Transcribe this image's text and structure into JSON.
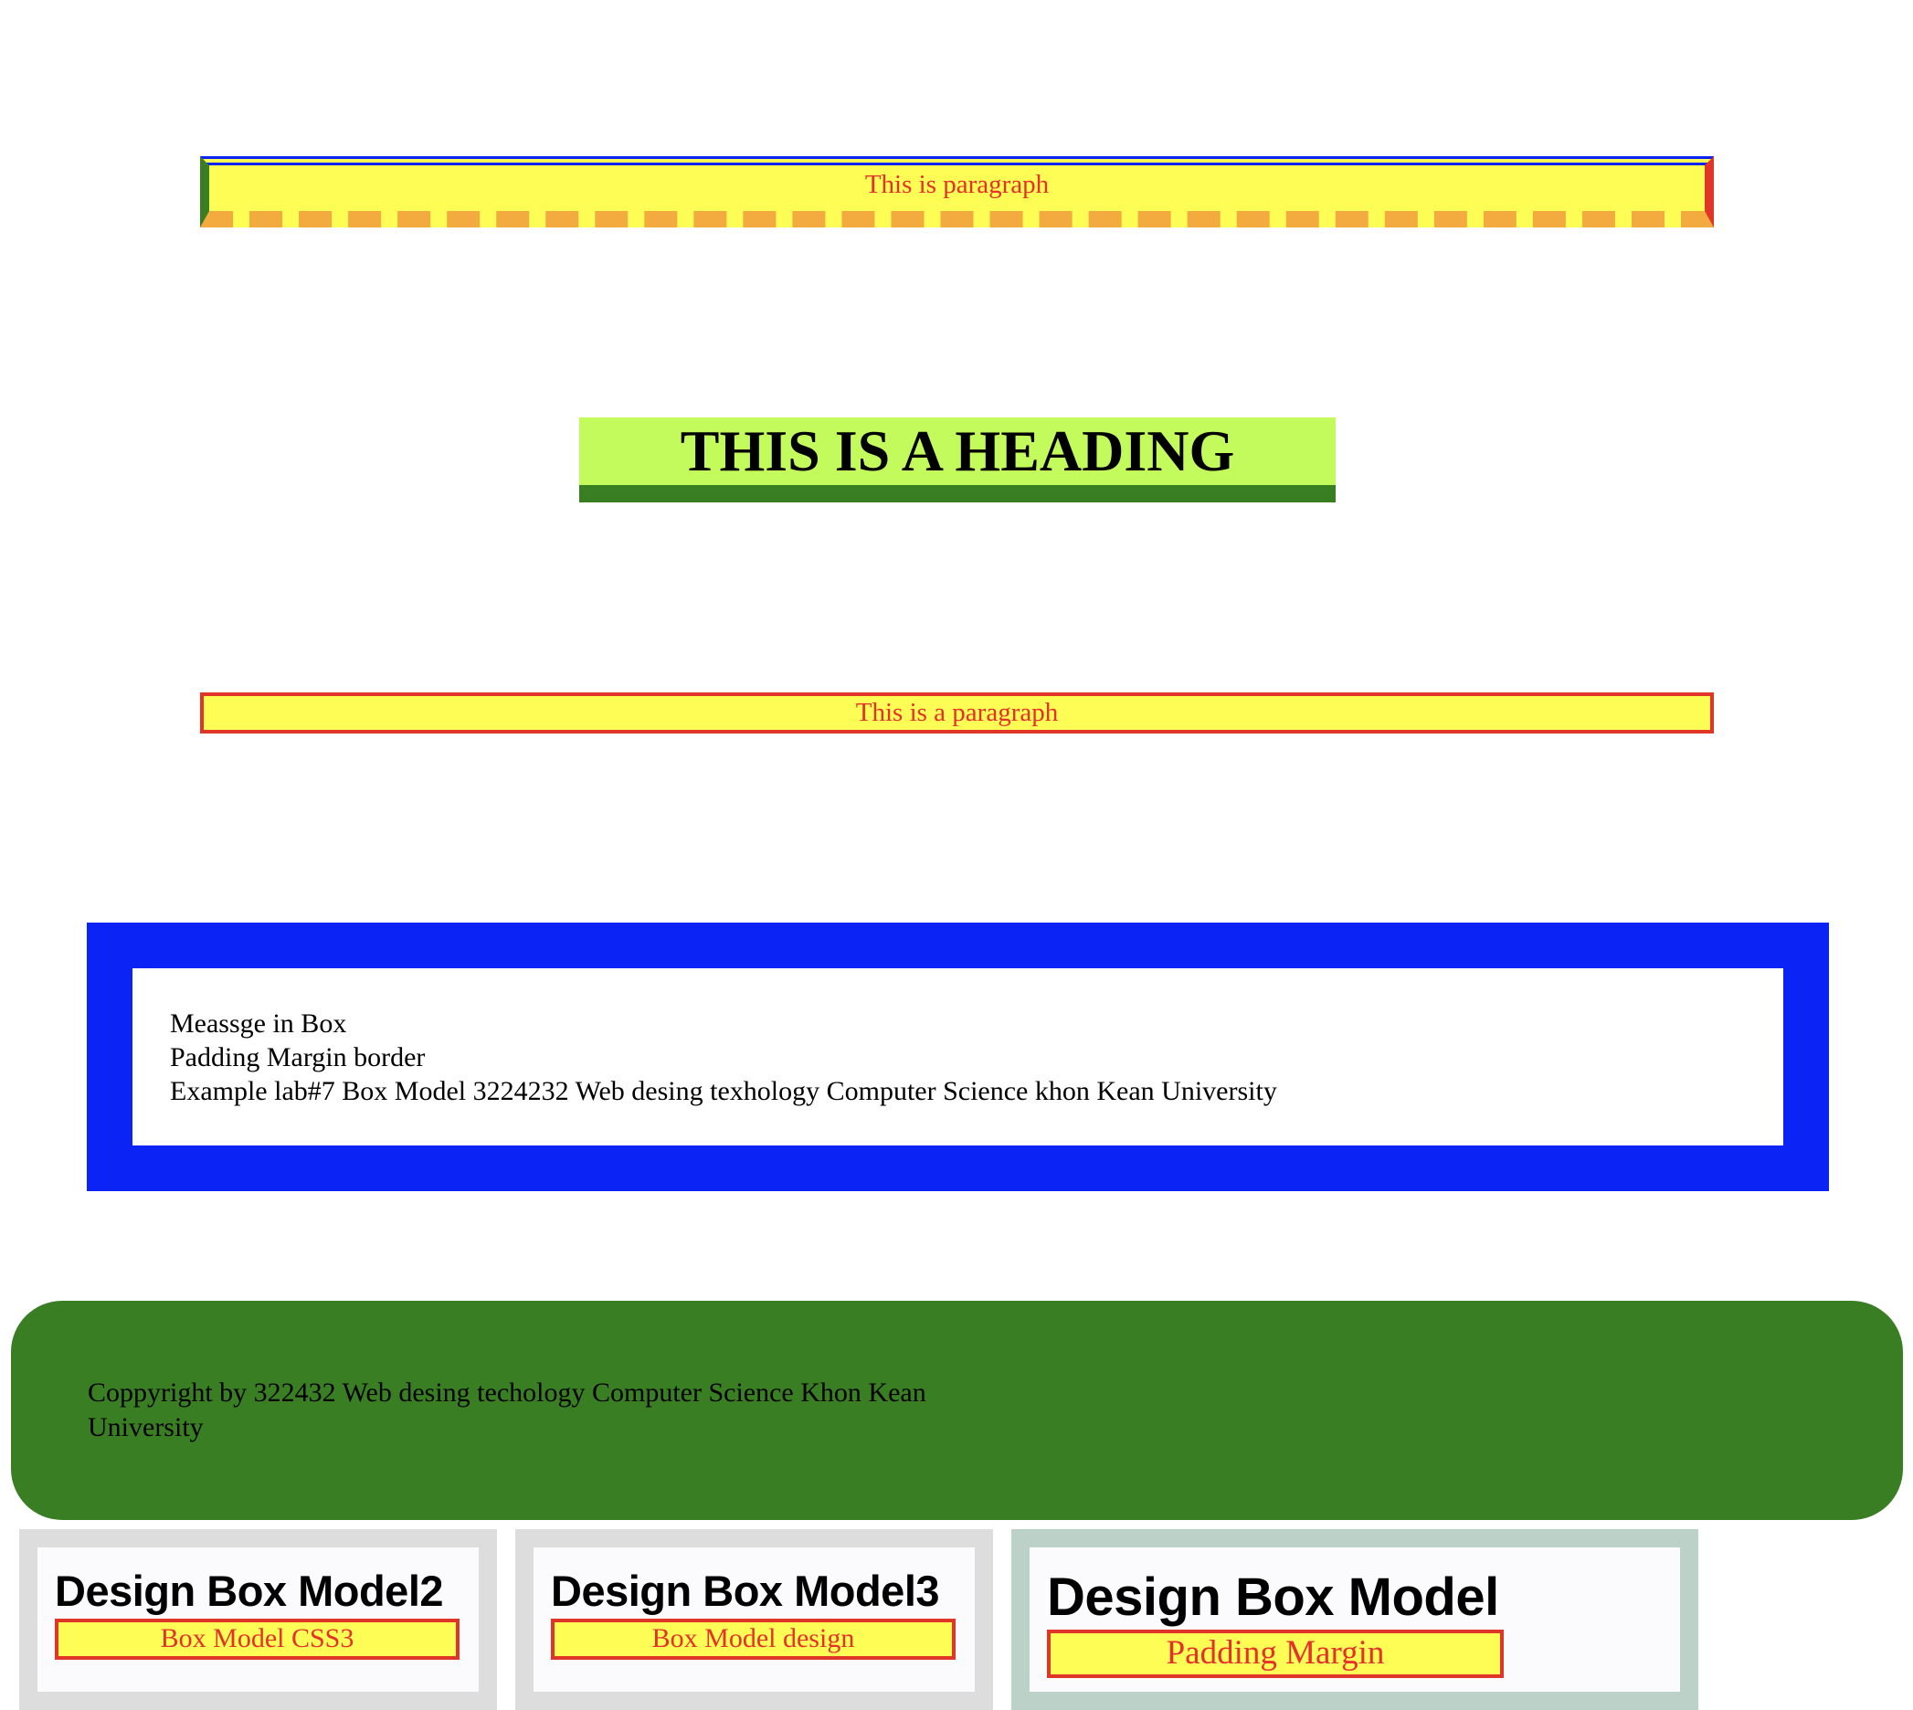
{
  "paragraph_1": {
    "text": "This is paragraph"
  },
  "heading": {
    "text": "THIS IS A HEADING"
  },
  "paragraph_2": {
    "text": "This is a paragraph"
  },
  "message_box": {
    "line1": "Meassge in Box",
    "line2": "Padding Margin border",
    "line3": "Example lab#7 Box Model 3224232 Web desing texhology Computer Science khon Kean University"
  },
  "footer": {
    "text": "Coppyright by 322432 Web desing techology Computer Science Khon Kean University"
  },
  "cards": [
    {
      "title": "Design Box Model2",
      "tag": "Box Model CSS3"
    },
    {
      "title": "Design Box Model3",
      "tag": "Box Model design"
    },
    {
      "title": "Design Box Model",
      "tag": "Padding Margin"
    }
  ],
  "colors": {
    "yellow": "#fefd56",
    "red": "#e03529",
    "blue": "#0b24f5",
    "green": "#3a7e23",
    "orange": "#f3aa3e",
    "lime": "#c4fb5c"
  }
}
